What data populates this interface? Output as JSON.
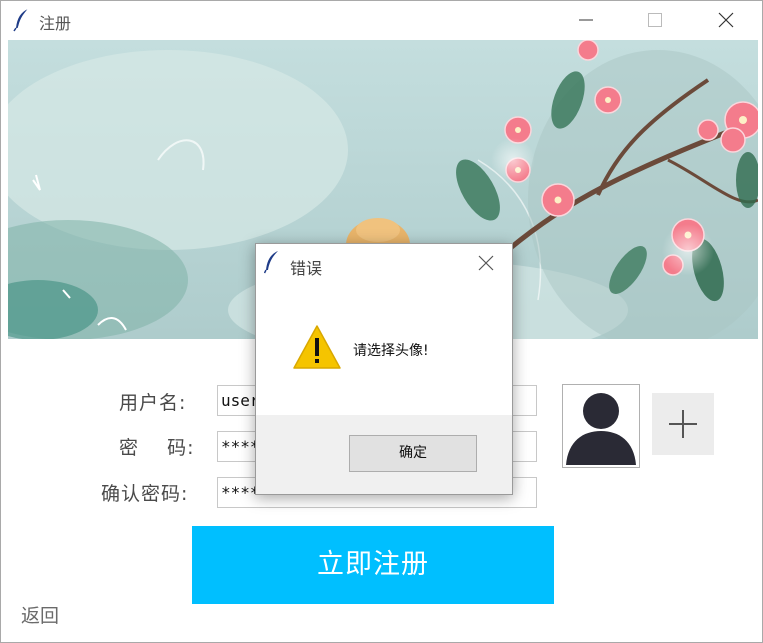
{
  "window": {
    "title": "注册",
    "app_icon": "feather-icon"
  },
  "form": {
    "username_label": "用户名:",
    "password_label": "密    码:",
    "confirm_label": "确认密码:",
    "username_value": "user",
    "password_value": "*****",
    "confirm_value": "*****"
  },
  "actions": {
    "register_label": "立即注册",
    "back_label": "返回",
    "add_avatar_icon": "plus-icon"
  },
  "dialog": {
    "title": "错误",
    "message": "请选择头像!",
    "ok_label": "确定",
    "icon": "warning-icon"
  },
  "colors": {
    "register_button": "#00bfff",
    "warning": "#f5c400"
  }
}
